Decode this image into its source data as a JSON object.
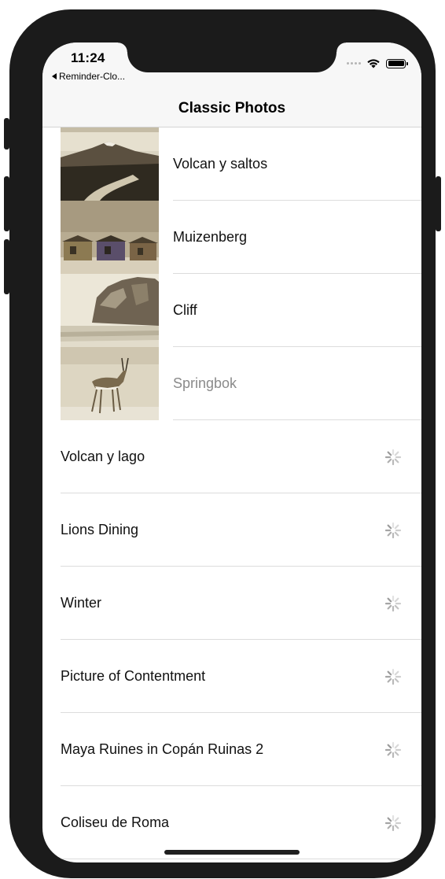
{
  "status": {
    "time": "11:24",
    "back_app": "Reminder-Clo...",
    "icons": [
      "signal-dots-icon",
      "wifi-icon",
      "battery-icon"
    ]
  },
  "navbar": {
    "title": "Classic Photos"
  },
  "photos": [
    {
      "label": "Volcan y saltos",
      "icon": "volcano-photo",
      "loaded": true
    },
    {
      "label": "Muizenberg",
      "icon": "beach-huts-photo",
      "loaded": true
    },
    {
      "label": "Cliff",
      "icon": "cliff-photo",
      "loaded": true
    },
    {
      "label": "Springbok",
      "icon": "springbok-photo",
      "loaded": true
    },
    {
      "label": "Volcan y lago",
      "icon": "activity-spinner-icon",
      "loaded": false
    },
    {
      "label": "Lions Dining",
      "icon": "activity-spinner-icon",
      "loaded": false
    },
    {
      "label": "Winter",
      "icon": "activity-spinner-icon",
      "loaded": false
    },
    {
      "label": "Picture of Contentment",
      "icon": "activity-spinner-icon",
      "loaded": false
    },
    {
      "label": "Maya Ruines in Copán Ruinas 2",
      "icon": "activity-spinner-icon",
      "loaded": false
    },
    {
      "label": "Coliseu de Roma",
      "icon": "activity-spinner-icon",
      "loaded": false
    }
  ],
  "colors": {
    "sepia_dark": "#3a3326",
    "sepia_light": "#e9e3d2",
    "separator": "#dcdcdc"
  }
}
